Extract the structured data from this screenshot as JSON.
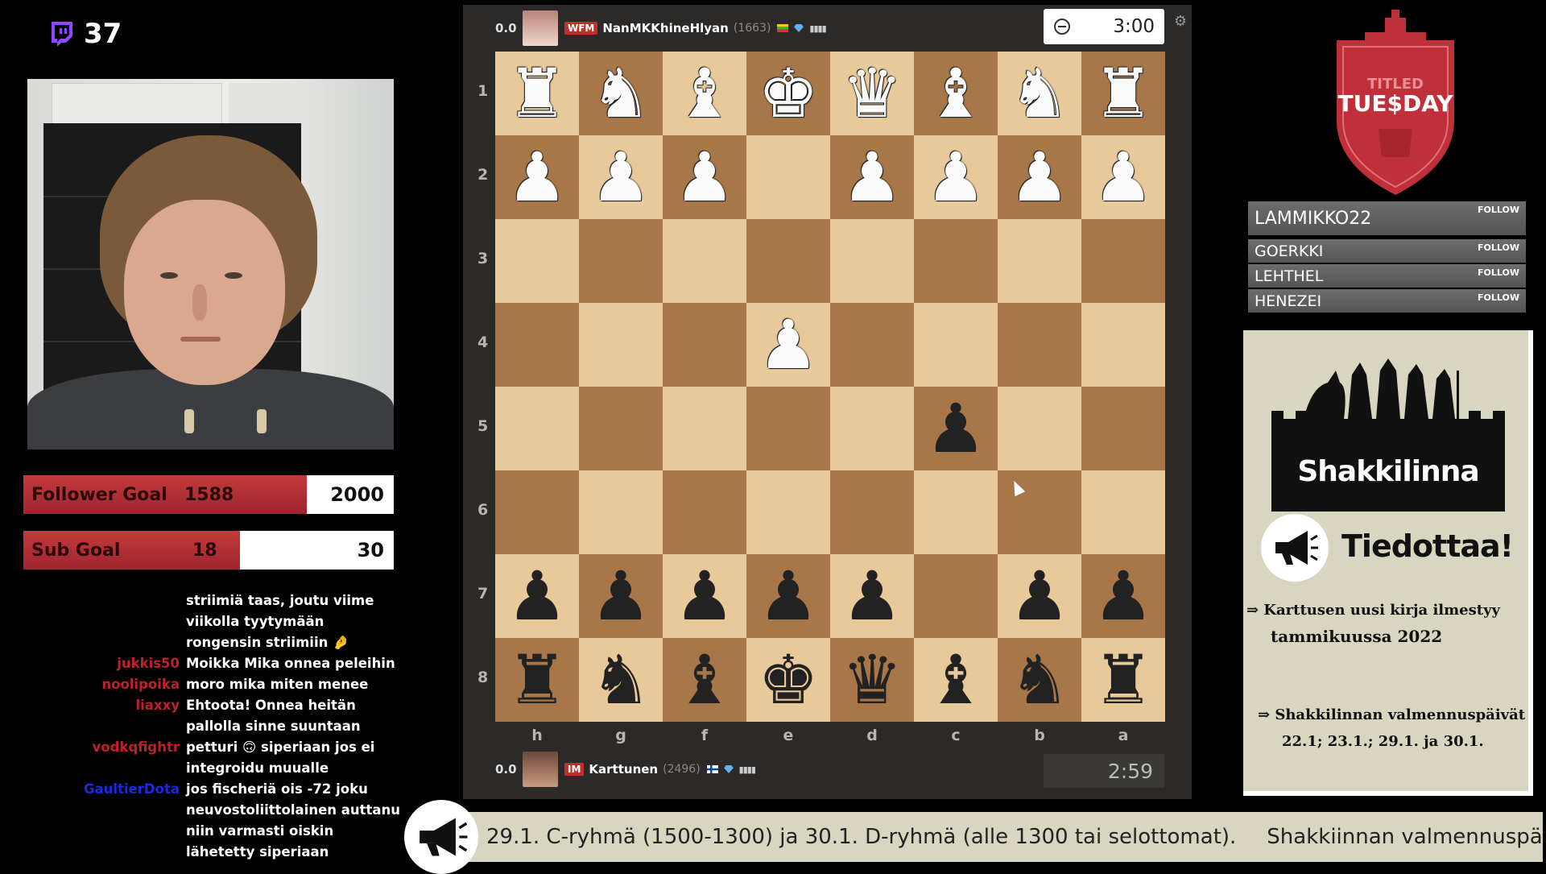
{
  "viewer_count": "37",
  "goals": {
    "follower": {
      "label": "Follower Goal",
      "current": "1588",
      "target": "2000",
      "progress": 0.794
    },
    "sub": {
      "label": "Sub Goal",
      "current": "18",
      "target": "30",
      "progress": 0.6
    }
  },
  "chat": [
    {
      "user": "",
      "user_color": "#ffffff",
      "text": "striimiä taas, joutu viime viikolla tyytymään rongensin striimiin 🤌"
    },
    {
      "user": "jukkis50",
      "user_color": "#c0202a",
      "text": "Moikka Mika onnea peleihin"
    },
    {
      "user": "noolipoika",
      "user_color": "#c0202a",
      "text": "moro mika miten menee"
    },
    {
      "user": "liaxxy",
      "user_color": "#c0202a",
      "text": "Ehtoota! Onnea heitän pallolla sinne suuntaan"
    },
    {
      "user": "vodkqfightr",
      "user_color": "#c0202a",
      "text": "petturi 🙃 siperiaan jos ei integroidu muualle"
    },
    {
      "user": "GaultierDota",
      "user_color": "#1a2adf",
      "text": "jos fischeriä ois -72 joku neuvostoliittolainen auttanu niin varmasti oiskin lähetetty siperiaan"
    }
  ],
  "top_player": {
    "score": "0.0",
    "title": "WFM",
    "name": "NanMKKhineHlyan",
    "rating": "(1663)",
    "clock": "3:00"
  },
  "bottom_player": {
    "score": "0.0",
    "title": "IM",
    "name": "Karttunen",
    "rating": "(2496)",
    "clock": "2:59"
  },
  "board": {
    "ranks": [
      "1",
      "2",
      "3",
      "4",
      "5",
      "6",
      "7",
      "8"
    ],
    "files": [
      "h",
      "g",
      "f",
      "e",
      "d",
      "c",
      "b",
      "a"
    ],
    "rows": [
      [
        "wR",
        "wN",
        "wB",
        "wK",
        "wQ",
        "wB",
        "wN",
        "wR"
      ],
      [
        "wP",
        "wP",
        "wP",
        "",
        "wP",
        "wP",
        "wP",
        "wP"
      ],
      [
        "",
        "",
        "",
        "",
        "",
        "",
        "",
        ""
      ],
      [
        "",
        "",
        "",
        "wP",
        "",
        "",
        "",
        ""
      ],
      [
        "",
        "",
        "",
        "",
        "",
        "bP",
        "",
        ""
      ],
      [
        "",
        "",
        "",
        "",
        "",
        "",
        "",
        ""
      ],
      [
        "bP",
        "bP",
        "bP",
        "bP",
        "bP",
        "",
        "bP",
        "bP"
      ],
      [
        "bR",
        "bN",
        "bB",
        "bK",
        "bQ",
        "bB",
        "bN",
        "bR"
      ]
    ]
  },
  "logo": {
    "line1": "TITLED",
    "line2": "TUE$DAY",
    "color": "#c0303a"
  },
  "follow_list": [
    {
      "name": "LAMMIKKO22",
      "action": "FOLLOW"
    },
    {
      "name": "GOERKKI",
      "action": "FOLLOW"
    },
    {
      "name": "LEHTHEL",
      "action": "FOLLOW"
    },
    {
      "name": "HENEZEI",
      "action": "FOLLOW"
    }
  ],
  "announcement": {
    "brand": "Shakkilinna",
    "heading": "Tiedottaa!",
    "item1_a": "⇒ Karttusen uusi kirja ilmestyy",
    "item1_b": "tammikuussa 2022",
    "item2_a": "⇒ Shakkilinnan valmennuspäivät",
    "item2_b": "22.1; 23.1.; 29.1. ja 30.1."
  },
  "ticker": {
    "text1": "29.1. C-ryhmä (1500-1300) ja 30.1. D-ryhmä (alle 1300 tai selottomat).",
    "text2": "Shakkiinnan valmennuspä"
  }
}
